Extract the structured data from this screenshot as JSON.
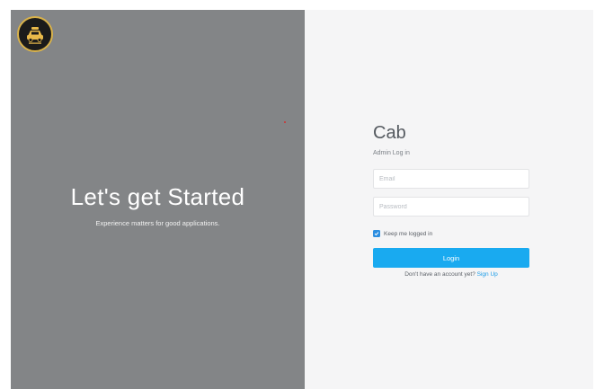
{
  "left_panel": {
    "logo_icon": "taxi-logo-icon",
    "headline": "Let's get Started",
    "tagline": "Experience matters for good applications."
  },
  "login_form": {
    "brand": "Cab",
    "subtitle": "Admin Log in",
    "email": {
      "placeholder": "Email",
      "value": ""
    },
    "password": {
      "placeholder": "Password",
      "value": ""
    },
    "remember_me": {
      "label": "Keep me logged in",
      "checked": true
    },
    "submit_label": "Login",
    "signup_prompt": "Don't have an account yet?",
    "signup_link": "Sign Up"
  },
  "colors": {
    "left_panel_bg": "#838587",
    "right_panel_bg": "#f5f5f6",
    "accent": "#19aaf0",
    "link": "#1a9ce8"
  }
}
